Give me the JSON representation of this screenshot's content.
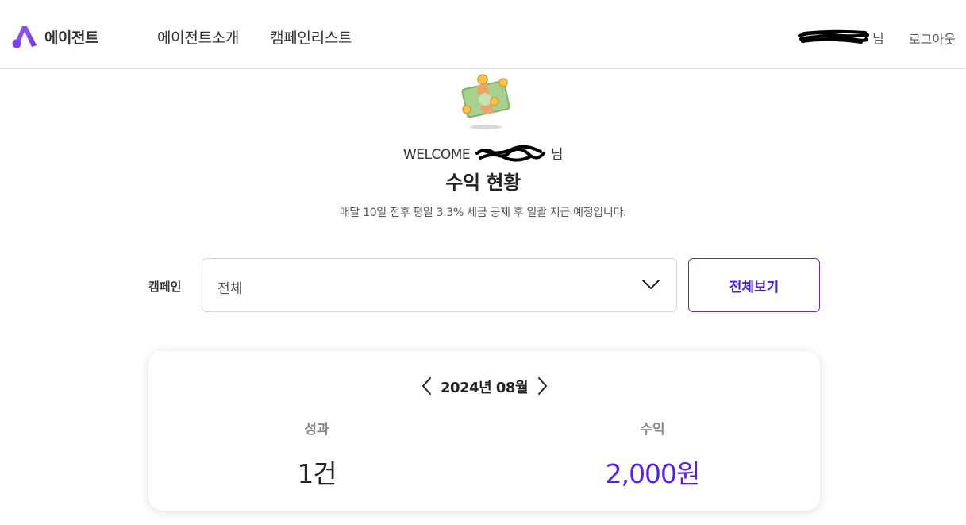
{
  "header": {
    "logo_text": "에이전트",
    "nav": [
      "에이전트소개",
      "캠페인리스트"
    ],
    "user_honorific": "님",
    "logout_label": "로그아웃"
  },
  "hero": {
    "welcome_prefix": "WELCOME",
    "welcome_suffix": "님",
    "title": "수익 현황",
    "subtitle": "매달 10일 전후 평일 3.3% 세금 공제 후 일괄 지급 예정입니다."
  },
  "filter": {
    "label": "캠페인",
    "selected": "전체",
    "view_all_label": "전체보기"
  },
  "summary": {
    "month": "2024년 08월",
    "performance_label": "성과",
    "performance_value": "1건",
    "revenue_label": "수익",
    "revenue_value": "2,000원"
  },
  "colors": {
    "brand": "#7b3fe4",
    "accent_text": "#5520e6",
    "button_border": "#5b2ee0"
  },
  "icons": {
    "logo": "agent-logo-icon",
    "money": "money-stack-icon",
    "dropdown": "chevron-down-icon",
    "prev": "chevron-left-icon",
    "next": "chevron-right-icon"
  }
}
